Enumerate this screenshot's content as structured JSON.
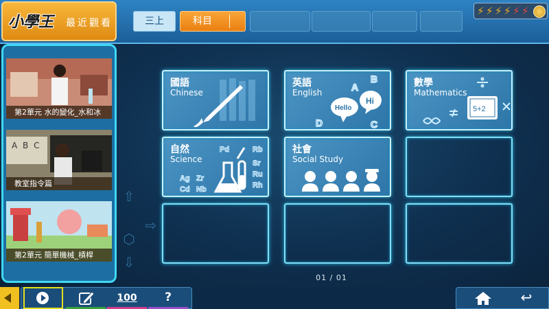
{
  "header": {
    "logo_text": "小學王",
    "recent_label": "最近觀看",
    "grade_tab": "三上",
    "subject_tab": "科目",
    "empty_tab_count": 4
  },
  "energy": {
    "bolts": 6,
    "colors": [
      "#f0b020",
      "#f0b020",
      "#f0b020",
      "#f0b020",
      "#e8453a",
      "#e8453a"
    ],
    "coin": "coin-icon"
  },
  "recent_videos": [
    {
      "title": "第2單元 水的變化_水和冰"
    },
    {
      "title": "教室指令篇",
      "board_text": "A B C"
    },
    {
      "title": "第2單元 簡單機械_槓桿"
    }
  ],
  "subjects": [
    {
      "zh": "國語",
      "en": "Chinese",
      "icon": "brush-icon"
    },
    {
      "zh": "英語",
      "en": "English",
      "icon": "speech-bubble-icon",
      "bubble1": "Hello",
      "bubble2": "Hi",
      "letters": [
        "A",
        "B",
        "C",
        "D"
      ]
    },
    {
      "zh": "數學",
      "en": "Mathematics",
      "icon": "math-board-icon",
      "board_text": "5+2"
    },
    {
      "zh": "自然",
      "en": "Science",
      "icon": "test-tube-icon",
      "elements": [
        "Pd",
        "Rb",
        "Sr",
        "Ru",
        "Rh",
        "Ag",
        "Zr",
        "Cd",
        "Nb"
      ]
    },
    {
      "zh": "社會",
      "en": "Social Study",
      "icon": "people-icon"
    }
  ],
  "pager": "01 / 01",
  "toolbar": {
    "score_label": "100",
    "help_label": "?",
    "colors": {
      "play": "#e6e020",
      "edit": "#3ca03c",
      "score": "#d23c8c",
      "help": "#9a4fc8"
    }
  },
  "accent": {
    "cyan": "#3fd8f4",
    "orange": "#f7a531",
    "bar": "#2f83c4"
  }
}
